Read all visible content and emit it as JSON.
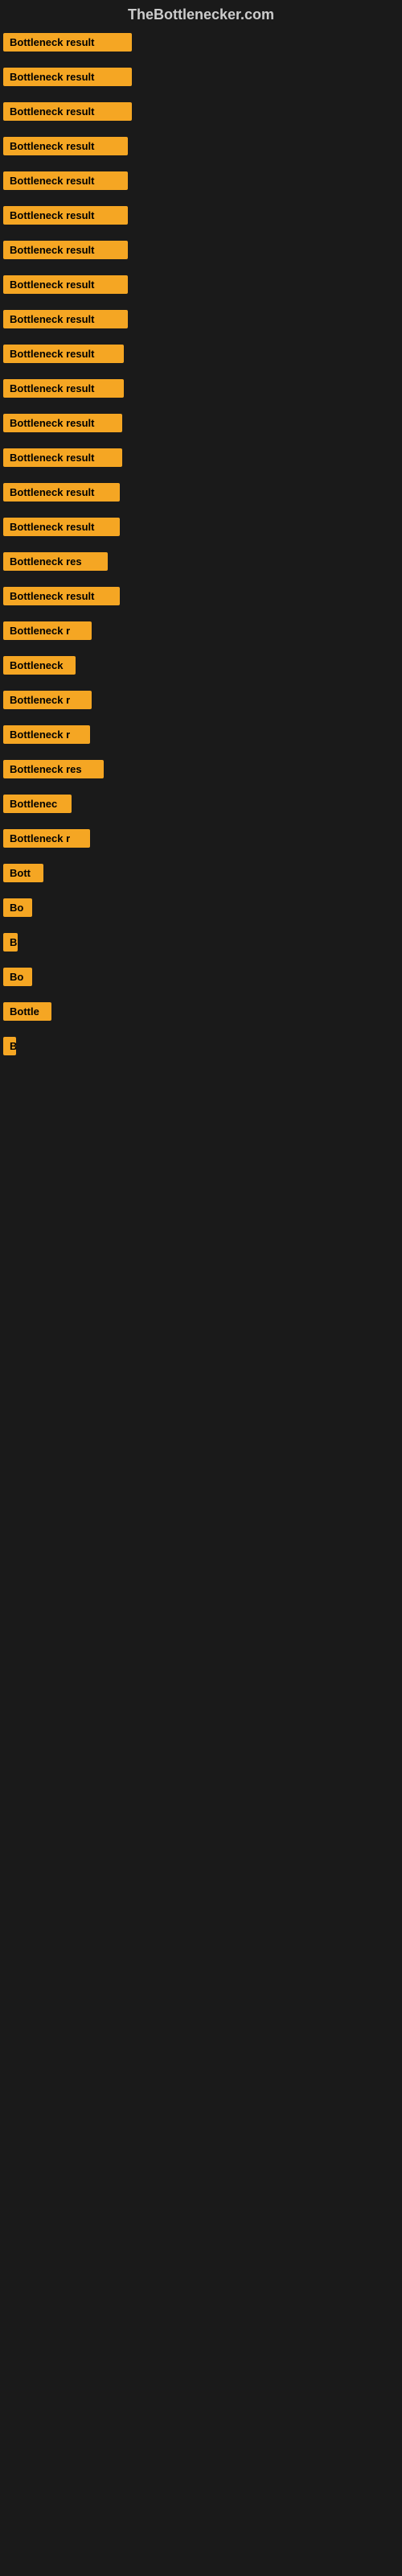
{
  "site": {
    "title": "TheBottlenecker.com"
  },
  "items": [
    {
      "label": "Bottleneck result",
      "width": 160
    },
    {
      "label": "Bottleneck result",
      "width": 160
    },
    {
      "label": "Bottleneck result",
      "width": 160
    },
    {
      "label": "Bottleneck result",
      "width": 155
    },
    {
      "label": "Bottleneck result",
      "width": 155
    },
    {
      "label": "Bottleneck result",
      "width": 155
    },
    {
      "label": "Bottleneck result",
      "width": 155
    },
    {
      "label": "Bottleneck result",
      "width": 155
    },
    {
      "label": "Bottleneck result",
      "width": 155
    },
    {
      "label": "Bottleneck result",
      "width": 150
    },
    {
      "label": "Bottleneck result",
      "width": 150
    },
    {
      "label": "Bottleneck result",
      "width": 148
    },
    {
      "label": "Bottleneck result",
      "width": 148
    },
    {
      "label": "Bottleneck result",
      "width": 145
    },
    {
      "label": "Bottleneck result",
      "width": 145
    },
    {
      "label": "Bottleneck res",
      "width": 130
    },
    {
      "label": "Bottleneck result",
      "width": 145
    },
    {
      "label": "Bottleneck r",
      "width": 110
    },
    {
      "label": "Bottleneck",
      "width": 90
    },
    {
      "label": "Bottleneck r",
      "width": 110
    },
    {
      "label": "Bottleneck r",
      "width": 108
    },
    {
      "label": "Bottleneck res",
      "width": 125
    },
    {
      "label": "Bottlenec",
      "width": 85
    },
    {
      "label": "Bottleneck r",
      "width": 108
    },
    {
      "label": "Bott",
      "width": 50
    },
    {
      "label": "Bo",
      "width": 36
    },
    {
      "label": "B",
      "width": 18
    },
    {
      "label": "Bo",
      "width": 36
    },
    {
      "label": "Bottle",
      "width": 60
    },
    {
      "label": "B",
      "width": 14
    }
  ]
}
